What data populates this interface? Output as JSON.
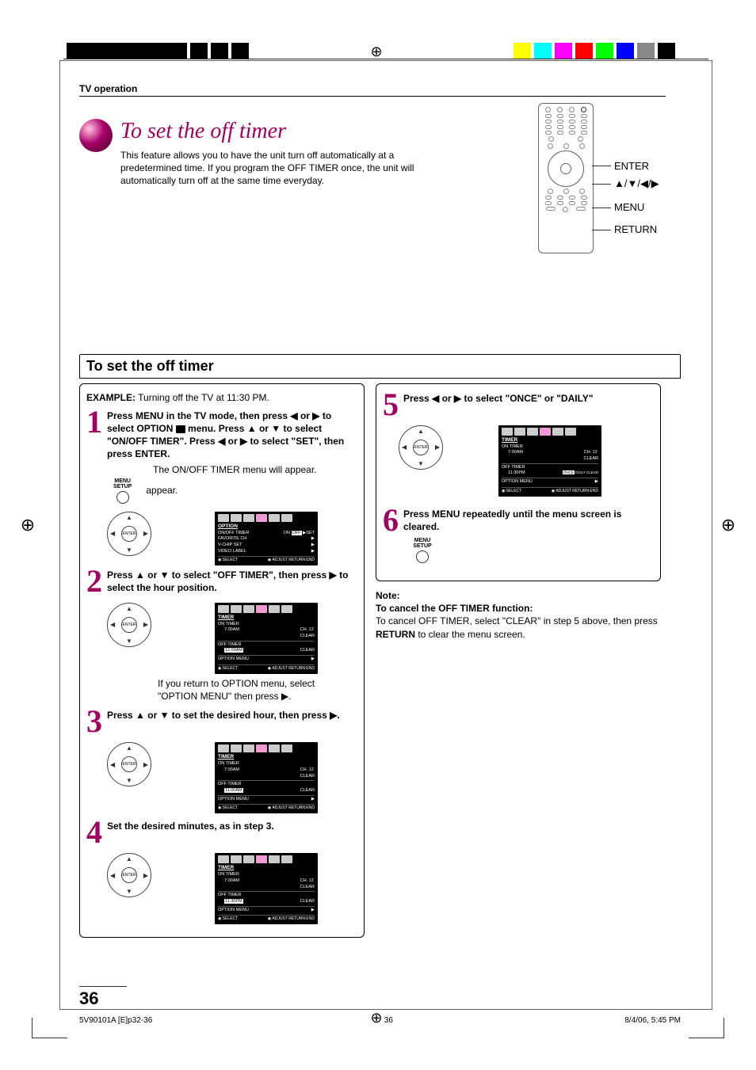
{
  "header": {
    "section": "TV operation"
  },
  "title": "To set the off timer",
  "intro": "This feature allows you to have the unit turn off automatically at a predetermined time. If you program the OFF TIMER once, the unit will automatically turn off at the same time everyday.",
  "remote_labels": {
    "enter": "ENTER",
    "arrows": "▲/▼/◀/▶",
    "menu": "MENU",
    "return": "RETURN"
  },
  "section_title": "To set the off timer",
  "example_label": "EXAMPLE:",
  "example_text": "Turning off the TV at 11:30 PM.",
  "steps": {
    "s1": {
      "num": "1",
      "text_pre": "Press MENU in the TV mode, then press ◀ or ▶ to select OPTION ",
      "text_post": " menu. Press ▲ or ▼ to select \"ON/OFF TIMER\". Press ◀ or ▶ to select \"SET\", then press ENTER.",
      "after": "The ON/OFF TIMER menu will appear.",
      "menu_label1": "MENU",
      "menu_label2": "SETUP"
    },
    "s2": {
      "num": "2",
      "text": "Press ▲ or ▼ to select \"OFF TIMER\", then press ▶ to select the hour position.",
      "after": "If you return to OPTION menu, select \"OPTION MENU\" then press ▶."
    },
    "s3": {
      "num": "3",
      "text": "Press ▲ or ▼ to set the desired hour, then press ▶."
    },
    "s4": {
      "num": "4",
      "text": "Set the desired minutes, as in step 3."
    },
    "s5": {
      "num": "5",
      "text": "Press ◀ or ▶ to select \"ONCE\" or \"DAILY\""
    },
    "s6": {
      "num": "6",
      "text": "Press MENU repeatedly until the menu screen is cleared.",
      "menu_label1": "MENU",
      "menu_label2": "SETUP"
    }
  },
  "osd_option": {
    "title": "OPTION",
    "rows": [
      [
        "ON/OFF TIMER",
        "ON OFF ▶SET"
      ],
      [
        "FAVORITE CH",
        "▶"
      ],
      [
        "V-CHIP SET",
        "▶"
      ],
      [
        "VIDEO LABEL",
        "▶"
      ]
    ],
    "footer_left": "◉:SELECT",
    "footer_right": "◉:ADJUST\nRETURN:END"
  },
  "osd_timer": {
    "title": "TIMER",
    "on_timer_label": "ON TIMER",
    "on_timer_val": "7:00AM",
    "ch_label": "CH. 12",
    "clear_label": "CLEAR",
    "off_timer_label": "OFF TIMER",
    "opt_menu_label": "OPTION MENU",
    "opt_menu_val": "▶",
    "footer_left": "◉:SELECT",
    "footer_right": "◉:ADJUST\nRETURN:END",
    "variants": {
      "s2": {
        "off_val": "12:00AM",
        "off_clear": "CLEAR"
      },
      "s3": {
        "off_val": "11:00AM",
        "off_clear": "CLEAR"
      },
      "s4": {
        "off_val": "11:30PM",
        "off_clear": "CLEAR"
      },
      "s5": {
        "off_val": "11:30PM",
        "off_clear": "ONCE DAILY CLEAR"
      }
    }
  },
  "note": {
    "heading": "Note:",
    "sub": "To cancel the OFF TIMER function:",
    "body_pre": "To cancel OFF TIMER, select \"CLEAR\" in step 5 above, then press ",
    "body_strong": "RETURN",
    "body_post": " to clear the menu screen."
  },
  "page_number": "36",
  "folio_left": "5V90101A [E]p32-36",
  "folio_center": "36",
  "folio_right": "8/4/06, 5:45 PM",
  "color_bars": [
    "#ff0000",
    "#ffff00",
    "#00ffff",
    "#00ff00",
    "#ff00ff",
    "#0000ff",
    "#888888",
    "#000000"
  ]
}
